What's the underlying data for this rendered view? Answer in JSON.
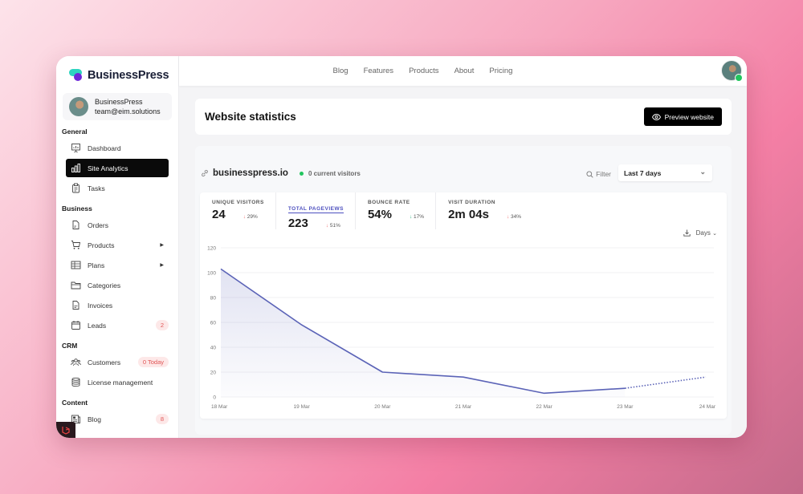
{
  "app": {
    "brand": "BusinessPress",
    "user": {
      "name": "BusinessPress",
      "email": "team@eim.solutions"
    }
  },
  "sidebar": {
    "sections": [
      {
        "title": "General",
        "items": [
          {
            "label": "Dashboard",
            "icon": "presentation-chart-icon"
          },
          {
            "label": "Site Analytics",
            "icon": "bar-chart-icon",
            "active": true
          },
          {
            "label": "Tasks",
            "icon": "clipboard-icon"
          }
        ]
      },
      {
        "title": "Business",
        "items": [
          {
            "label": "Orders",
            "icon": "document-icon"
          },
          {
            "label": "Products",
            "icon": "cart-icon",
            "has_submenu": true
          },
          {
            "label": "Plans",
            "icon": "table-icon",
            "has_submenu": true
          },
          {
            "label": "Categories",
            "icon": "folder-icon"
          },
          {
            "label": "Invoices",
            "icon": "invoice-icon"
          },
          {
            "label": "Leads",
            "icon": "calendar-icon",
            "badge": "2"
          }
        ]
      },
      {
        "title": "CRM",
        "items": [
          {
            "label": "Customers",
            "icon": "users-icon",
            "badge": "0 Today"
          },
          {
            "label": "License management",
            "icon": "database-icon"
          }
        ]
      },
      {
        "title": "Content",
        "items": [
          {
            "label": "Blog",
            "icon": "newspaper-icon",
            "badge": "8"
          }
        ]
      }
    ]
  },
  "topnav": {
    "links": [
      "Blog",
      "Features",
      "Products",
      "About",
      "Pricing"
    ]
  },
  "page": {
    "title": "Website statistics",
    "preview_button": "Preview website"
  },
  "stats": {
    "site": "businesspress.io",
    "current_visitors": "0 current visitors",
    "filter_label": "Filter",
    "range": "Last 7 days",
    "interval": "Days",
    "kpis": [
      {
        "label": "UNIQUE VISITORS",
        "value": "24",
        "delta": "29%",
        "direction": "down",
        "sentiment": "bad"
      },
      {
        "label": "TOTAL PAGEVIEWS",
        "value": "223",
        "delta": "51%",
        "direction": "down",
        "sentiment": "bad",
        "active": true
      },
      {
        "label": "BOUNCE RATE",
        "value": "54%",
        "delta": "17%",
        "direction": "down",
        "sentiment": "good"
      },
      {
        "label": "VISIT DURATION",
        "value": "2m 04s",
        "delta": "34%",
        "direction": "down",
        "sentiment": "bad"
      }
    ]
  },
  "chart_data": {
    "type": "area",
    "title": "",
    "xlabel": "",
    "ylabel": "",
    "categories": [
      "18 Mar",
      "19 Mar",
      "20 Mar",
      "21 Mar",
      "22 Mar",
      "23 Mar",
      "24 Mar"
    ],
    "series": [
      {
        "name": "Total pageviews",
        "values": [
          103,
          58,
          20,
          16,
          3,
          7,
          16
        ],
        "dashed_from_index": 5,
        "color": "#5b63b7"
      }
    ],
    "yticks": [
      0,
      20,
      40,
      60,
      80,
      100,
      120
    ],
    "ylim": [
      0,
      120
    ],
    "grid": true,
    "legend": "none"
  }
}
